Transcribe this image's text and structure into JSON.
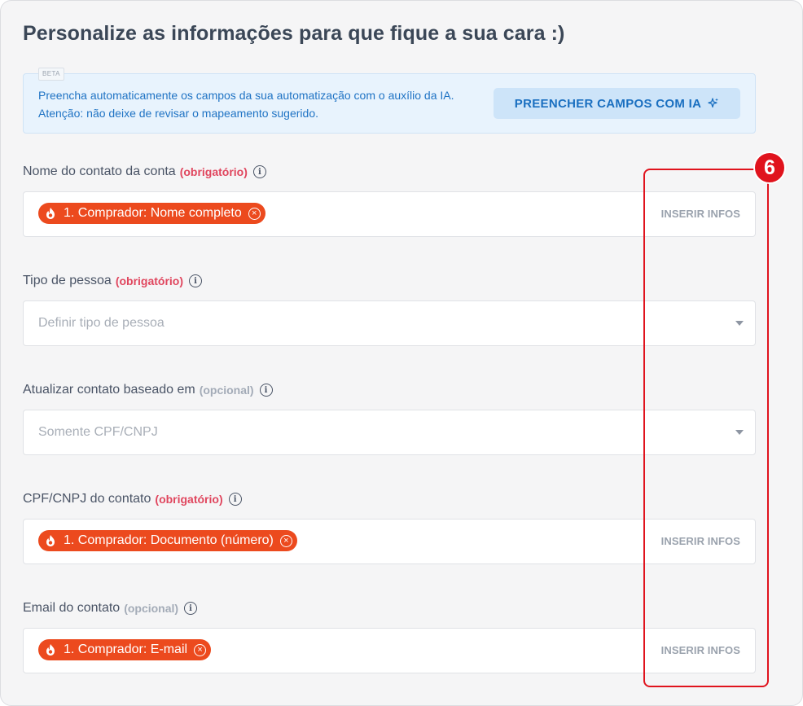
{
  "page_title": "Personalize as informações para que fique a sua cara :)",
  "ai_panel": {
    "badge": "BETA",
    "description": "Preencha automaticamente os campos da sua automatização com o auxílio da IA. Atenção: não deixe de revisar o mapeamento sugerido.",
    "button_label": "PREENCHER CAMPOS COM IA",
    "button_icon": "sparkles-icon"
  },
  "fields": [
    {
      "label": "Nome do contato da conta",
      "tag": "(obrigatório)",
      "chip": "1. Comprador: Nome completo",
      "action": "INSERIR INFOS"
    },
    {
      "label": "Tipo de pessoa",
      "tag": "(obrigatório)",
      "placeholder": "Definir tipo de pessoa"
    },
    {
      "label": "Atualizar contato baseado em",
      "tag": "(opcional)",
      "placeholder": "Somente CPF/CNPJ"
    },
    {
      "label": "CPF/CNPJ do contato",
      "tag": "(obrigatório)",
      "chip": "1. Comprador: Documento (número)",
      "action": "INSERIR INFOS"
    },
    {
      "label": "Email do contato",
      "tag": "(opcional)",
      "chip": "1. Comprador: E-mail",
      "action": "INSERIR INFOS"
    }
  ],
  "annotation": {
    "step_number": "6"
  },
  "colors": {
    "required": "#e0465e",
    "optional": "#a3abb7",
    "chip": "#ec4a1e",
    "highlight": "#e0131d",
    "ai_text": "#1f73c4"
  }
}
